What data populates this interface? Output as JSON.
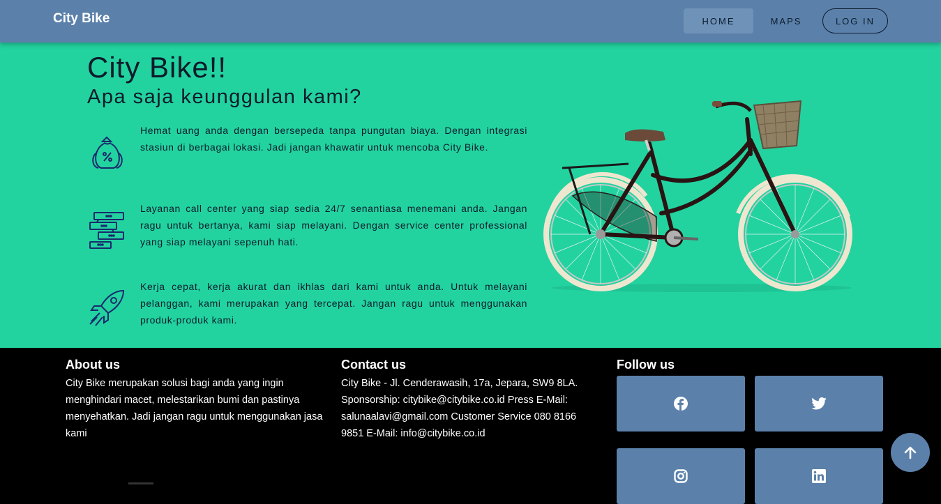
{
  "navbar": {
    "brand": "City Bike",
    "items": [
      {
        "label": "HOME"
      },
      {
        "label": "MAPS"
      },
      {
        "label": "LOG IN"
      }
    ]
  },
  "hero": {
    "title": "City Bike!!",
    "subtitle": "Apa saja keunggulan kami?",
    "features": [
      {
        "icon": "money-bag-icon",
        "text": "Hemat uang anda dengan bersepeda tanpa pungutan biaya. Dengan integrasi stasiun di berbagai lokasi. Jadi jangan khawatir untuk mencoba City Bike."
      },
      {
        "icon": "chat-messages-icon",
        "text": "Layanan call center yang siap sedia 24/7 senantiasa menemani anda. Jangan ragu untuk bertanya, kami siap melayani. Dengan service center professional yang siap melayani sepenuh hati."
      },
      {
        "icon": "rocket-icon",
        "text": "Kerja cepat, kerja akurat dan ikhlas dari kami untuk anda. Untuk melayani pelanggan, kami merupakan yang tercepat. Jangan ragu untuk menggunakan produk-produk kami."
      }
    ]
  },
  "footer": {
    "about": {
      "heading": "About us",
      "text": "City Bike merupakan solusi bagi anda yang ingin menghindari macet, melestarikan bumi dan pastinya menyehatkan. Jadi jangan ragu untuk menggunakan jasa kami"
    },
    "contact": {
      "heading": "Contact us",
      "text": "City Bike - Jl. Cenderawasih, 17a, Jepara, SW9 8LA. Sponsorship: citybike@citybike.co.id Press E-Mail: salunaalavi@gmail.com Customer Service 080 8166 9851 E-Mail: info@citybike.co.id"
    },
    "follow": {
      "heading": "Follow us",
      "icons": [
        "facebook-icon",
        "twitter-icon",
        "instagram-icon",
        "linkedin-icon"
      ]
    }
  },
  "colors": {
    "navbar": "#5b81ab",
    "hero": "#22d3a0",
    "footer": "#000000",
    "text_dark": "#0d1b2a"
  }
}
